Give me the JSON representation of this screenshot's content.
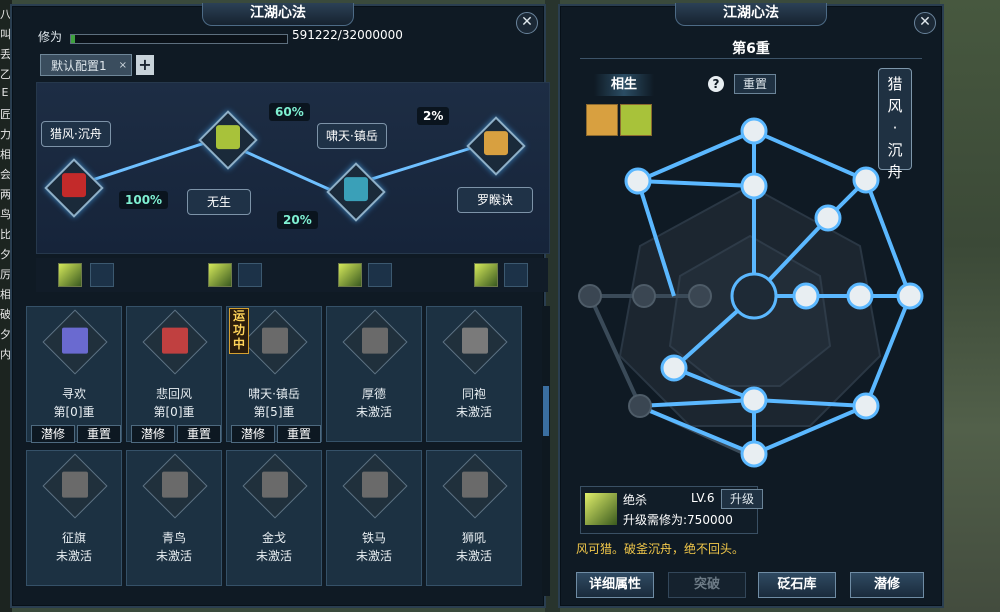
{
  "left_panel": {
    "title": "江湖心法",
    "close": "✕",
    "xiuwei_label": "修为",
    "xiuwei_value": "591222/32000000",
    "xiuwei_progress": 0.0185,
    "tab_label": "默认配置1",
    "tab_close": "×",
    "tab_add": "+",
    "path": {
      "nodes": [
        {
          "label": "猎风·沉舟"
        },
        {
          "label": "无生"
        },
        {
          "label": "啸天·镇岳"
        },
        {
          "label": "罗睺诀"
        }
      ],
      "percents": [
        "100%",
        "60%",
        "20%",
        "2%"
      ]
    },
    "cards": [
      {
        "name": "寻欢",
        "level": "第[0]重",
        "btn1": "潜修",
        "btn2": "重置"
      },
      {
        "name": "悲回风",
        "level": "第[0]重",
        "btn1": "潜修",
        "btn2": "重置"
      },
      {
        "name": "啸天·镇岳",
        "level": "第[5]重",
        "btn1": "潜修",
        "btn2": "重置",
        "badge": "运功中"
      },
      {
        "name": "厚德",
        "level": "未激活"
      },
      {
        "name": "同袍",
        "level": "未激活"
      },
      {
        "name": "征旗",
        "level": "未激活"
      },
      {
        "name": "青鸟",
        "level": "未激活"
      },
      {
        "name": "金戈",
        "level": "未激活"
      },
      {
        "name": "铁马",
        "level": "未激活"
      },
      {
        "name": "狮吼",
        "level": "未激活"
      }
    ]
  },
  "right_panel": {
    "title": "江湖心法",
    "close": "✕",
    "chong": "第6重",
    "xiangsheng": "相生",
    "help": "?",
    "reset": "重置",
    "vertical_title": "猎风·沉舟",
    "skill": {
      "name": "绝杀",
      "level": "LV.6",
      "upgrade": "升级",
      "need": "升级需修为:750000"
    },
    "flavor": "风可猎。破釜沉舟，绝不回头。",
    "buttons": [
      "详细属性",
      "突破",
      "砭石库",
      "潜修"
    ]
  },
  "side_letters": [
    "八",
    "叫",
    "丢",
    "乙",
    "E",
    "匠",
    "力",
    "相",
    "会",
    "两",
    "鸟",
    "比",
    "夕",
    "厉",
    "相",
    "破",
    "夕",
    "内"
  ],
  "colors": {
    "accent": "#3aa0e8",
    "gold": "#f2c84a",
    "teal": "#7ff0d2"
  }
}
